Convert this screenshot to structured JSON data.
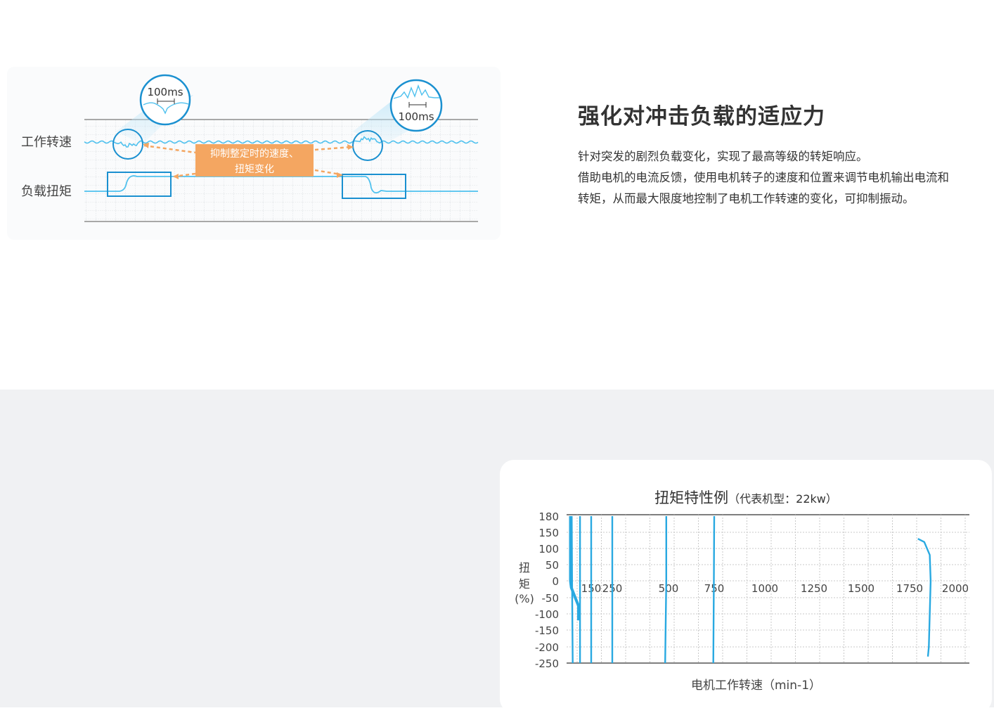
{
  "feature": {
    "heading": "强化对冲击负载的适应力",
    "lines": [
      "针对突发的剧烈负载变化，实现了最高等级的转矩响应。",
      "借助电机的电流反馈，使用电机转子的速度和位置来调节电机输出电流和",
      "转矩，从而最大限度地控制了电机工作转速的变化，可抑制振动。"
    ]
  },
  "diagram": {
    "row_speed": "工作转速",
    "row_load": "负载扭矩",
    "zoom_left": "100ms",
    "zoom_right": "100ms",
    "callout_line1": "抑制整定时的速度、",
    "callout_line2": "扭矩变化",
    "colors": {
      "wave": "#4fc1ee",
      "callout": "#f4a661",
      "frame": "#1a90d0"
    }
  },
  "chart_data": {
    "type": "line",
    "title": "扭矩特性例",
    "subtitle": "（代表机型：22kw）",
    "xlabel": "电机工作转速（min-1）",
    "ylabel": [
      "扭",
      "矩",
      "(%)"
    ],
    "x_ticks": [
      "150",
      "250",
      "500",
      "750",
      "1000",
      "1250",
      "1500",
      "1750",
      "2000"
    ],
    "y_ticks": [
      "180",
      "150",
      "100",
      "50",
      "0",
      "-50",
      "-100",
      "-150",
      "-200",
      "-250"
    ],
    "grid": true,
    "color": "#29a9e1",
    "series": [
      {
        "points": [
          [
            20,
            180
          ],
          [
            20,
            0
          ],
          [
            25,
            -20
          ],
          [
            50,
            -50
          ],
          [
            70,
            -75
          ],
          [
            70,
            -120
          ]
        ]
      },
      {
        "points": [
          [
            28,
            180
          ],
          [
            30,
            0
          ],
          [
            32,
            -150
          ],
          [
            34,
            -250
          ]
        ]
      },
      {
        "points": [
          [
            80,
            180
          ],
          [
            80,
            0
          ],
          [
            80,
            -100
          ],
          [
            80,
            -250
          ]
        ]
      },
      {
        "points": [
          [
            150,
            180
          ],
          [
            150,
            0
          ],
          [
            150,
            -250
          ]
        ]
      },
      {
        "points": [
          [
            250,
            180
          ],
          [
            250,
            0
          ],
          [
            250,
            -250
          ]
        ]
      },
      {
        "points": [
          [
            490,
            180
          ],
          [
            490,
            0
          ],
          [
            485,
            -250
          ]
        ]
      },
      {
        "points": [
          [
            750,
            180
          ],
          [
            748,
            0
          ],
          [
            745,
            -250
          ]
        ]
      },
      {
        "points": [
          [
            1795,
            130
          ],
          [
            1830,
            120
          ],
          [
            1860,
            80
          ],
          [
            1865,
            0
          ],
          [
            1860,
            -100
          ],
          [
            1855,
            -200
          ],
          [
            1850,
            -230
          ]
        ]
      }
    ]
  }
}
